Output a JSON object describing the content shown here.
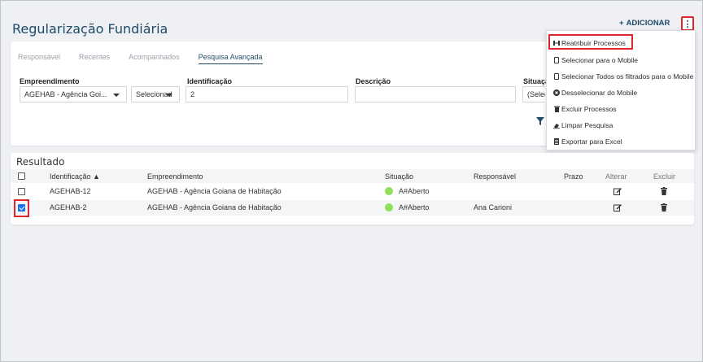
{
  "header": {
    "title": "Regularização Fundiária",
    "add_label": "ADICIONAR",
    "add_symbol": "+",
    "more_symbol": "⋮"
  },
  "tabs": [
    {
      "label": "Responsável",
      "active": false
    },
    {
      "label": "Recentes",
      "active": false
    },
    {
      "label": "Acompanhados",
      "active": false
    },
    {
      "label": "Pesquisa Avançada",
      "active": true
    }
  ],
  "filters": {
    "empreendimento": {
      "label": "Empreendimento",
      "value": "AGEHAB - Agência Goi...",
      "mode": "Selecionad"
    },
    "identificacao": {
      "label": "Identificação",
      "value": "2"
    },
    "descricao": {
      "label": "Descrição",
      "value": ""
    },
    "situacao": {
      "label": "Situaçã",
      "value": "(Selec"
    }
  },
  "menu": {
    "items": [
      {
        "label": "Reatribuir Processos",
        "icon": "reassign-icon"
      },
      {
        "label": "Selecionar para o Mobile",
        "icon": "mobile-icon"
      },
      {
        "label": "Selecionar Todos os filtrados para o Mobile",
        "icon": "mobile-icon"
      },
      {
        "label": "Desselecionar do Mobile",
        "icon": "remove-circle-icon"
      },
      {
        "label": "Excluir Processos",
        "icon": "trash-icon"
      },
      {
        "label": "Limpar Pesquisa",
        "icon": "eraser-icon"
      },
      {
        "label": "Exportar para Excel",
        "icon": "excel-file-icon"
      }
    ]
  },
  "results": {
    "title": "Resultado",
    "columns": {
      "identificacao": "Identificação ▲",
      "empreendimento": "Empreendimento",
      "situacao": "Situação",
      "responsavel": "Responsável",
      "prazo": "Prazo",
      "alterar": "Alterar",
      "excluir": "Excluir"
    },
    "rows": [
      {
        "id": "AGEHAB-12",
        "empreendimento": "AGEHAB - Agência Goiana de Habitação",
        "situacao": "A#Aberto",
        "responsavel": "",
        "prazo": "",
        "checked": false
      },
      {
        "id": "AGEHAB-2",
        "empreendimento": "AGEHAB - Agência Goiana de Habitação",
        "situacao": "A#Aberto",
        "responsavel": "Ana Carioni",
        "prazo": "",
        "checked": true
      }
    ]
  },
  "colors": {
    "title": "#1e4a66",
    "highlight": "#e0262d",
    "status_open": "#8fe05a",
    "checkbox_checked": "#1a73e8"
  }
}
